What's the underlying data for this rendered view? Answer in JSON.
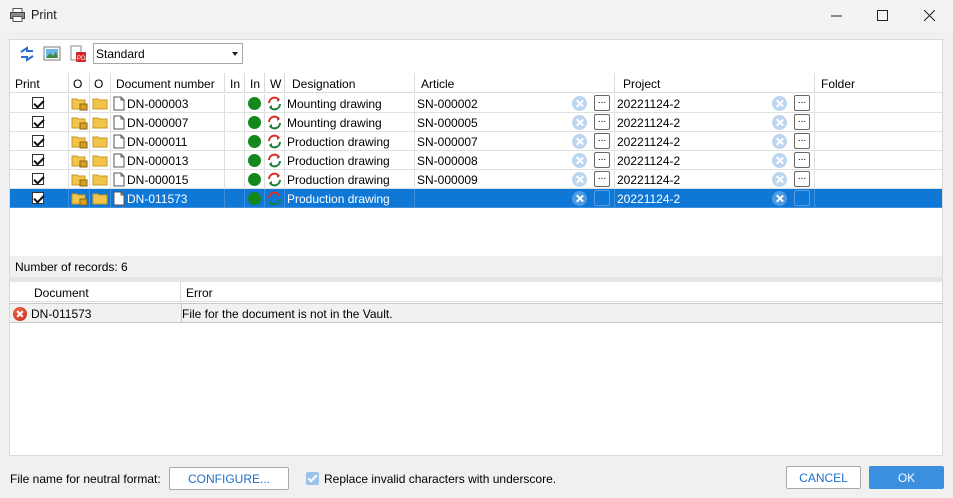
{
  "window": {
    "title": "Print"
  },
  "toolbar": {
    "view_selected": "Standard"
  },
  "grid": {
    "columns": [
      "Print",
      "O",
      "O",
      "Document number",
      "In",
      "In",
      "W",
      "Designation",
      "Article",
      "Project",
      "Folder"
    ],
    "rows": [
      {
        "print": true,
        "document_number": "DN-000003",
        "designation": "Mounting drawing",
        "article": "SN-000002",
        "project": "20221124-2",
        "selected": false
      },
      {
        "print": true,
        "document_number": "DN-000007",
        "designation": "Mounting drawing",
        "article": "SN-000005",
        "project": "20221124-2",
        "selected": false
      },
      {
        "print": true,
        "document_number": "DN-000011",
        "designation": "Production drawing",
        "article": "SN-000007",
        "project": "20221124-2",
        "selected": false
      },
      {
        "print": true,
        "document_number": "DN-000013",
        "designation": "Production drawing",
        "article": "SN-000008",
        "project": "20221124-2",
        "selected": false
      },
      {
        "print": true,
        "document_number": "DN-000015",
        "designation": "Production drawing",
        "article": "SN-000009",
        "project": "20221124-2",
        "selected": false
      },
      {
        "print": true,
        "document_number": "DN-011573",
        "designation": "Production drawing",
        "article": "",
        "project": "20221124-2",
        "selected": true
      }
    ],
    "records_text": "Number of records: 6",
    "dots_label": "..."
  },
  "errors": {
    "columns": [
      "Document",
      "Error"
    ],
    "rows": [
      {
        "document": "DN-011573",
        "error": "File for the document is not in the Vault."
      }
    ]
  },
  "footer": {
    "neutral_format_label": "File name for neutral format:",
    "configure_label": "CONFIGURE...",
    "replace_checked": true,
    "replace_label": "Replace invalid characters with underscore.",
    "cancel_label": "CANCEL",
    "ok_label": "OK"
  },
  "colors": {
    "selection": "#0f78d6",
    "status_green": "#14881c",
    "accent": "#1f6fc8"
  }
}
